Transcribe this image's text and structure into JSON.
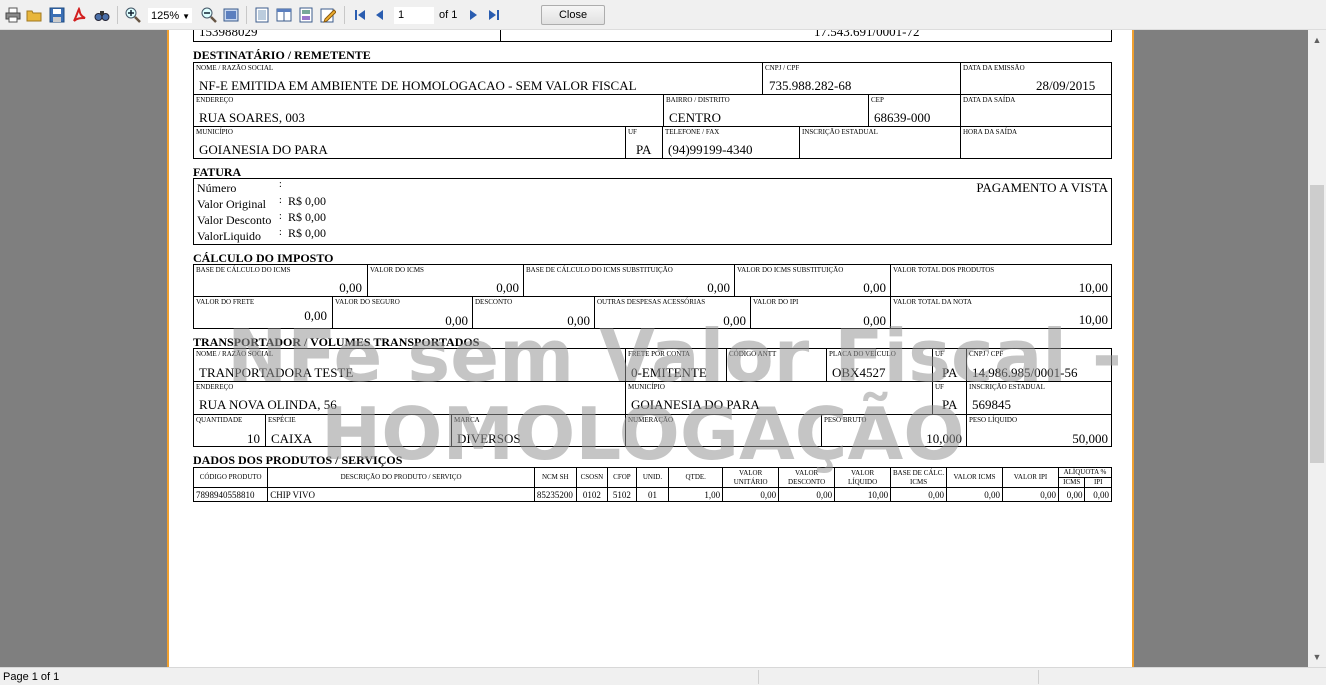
{
  "toolbar": {
    "zoom": "125%",
    "page_value": "1",
    "page_of": "of 1",
    "close_label": "Close",
    "icons": [
      "print-icon",
      "open-icon",
      "save-icon",
      "pdf-icon",
      "find-icon",
      "zoom-in-icon",
      "zoom-out-icon",
      "fit-page-icon",
      "single-page-icon",
      "two-page-icon",
      "thumbnails-icon",
      "edit-icon",
      "first-page-icon",
      "prev-page-icon",
      "next-page-icon",
      "last-page-icon"
    ]
  },
  "status": {
    "page_label": "Page 1 of 1"
  },
  "watermark": {
    "line1": "NFe sem Valor Fiscal -",
    "line2": "HOMOLOGAÇÃO"
  },
  "top_partial": {
    "left": "153988029",
    "right": "17.543.691/0001-72"
  },
  "dest": {
    "title": "DESTINATÁRIO / REMETENTE",
    "nome_label": "NOME / RAZÃO SOCIAL",
    "nome": "NF-E EMITIDA EM AMBIENTE DE HOMOLOGACAO - SEM VALOR FISCAL",
    "cnpj_label": "CNPJ / CPF",
    "cnpj": "735.988.282-68",
    "emissao_label": "DATA DA EMISSÃO",
    "emissao": "28/09/2015",
    "endereco_label": "ENDEREÇO",
    "endereco": "RUA SOARES, 003",
    "bairro_label": "BAIRRO / DISTRITO",
    "bairro": "CENTRO",
    "cep_label": "CEP",
    "cep": "68639-000",
    "saida_label": "DATA DA SAÍDA",
    "municipio_label": "MUNICÍPIO",
    "municipio": "GOIANESIA DO PARA",
    "uf_label": "UF",
    "uf": "PA",
    "fone_label": "TELEFONE / FAX",
    "fone": "(94)99199-4340",
    "ie_label": "INSCRIÇÃO ESTADUAL",
    "hora_label": "HORA DA SAÍDA"
  },
  "fatura": {
    "title": "FATURA",
    "numero_label": "Número",
    "original_label": "Valor Original",
    "desconto_label": "Valor Desconto",
    "liquido_label": "ValorLiquido",
    "colon": ":",
    "original": "R$ 0,00",
    "desconto": "R$ 0,00",
    "liquido": "R$ 0,00",
    "pagamento": "PAGAMENTO A VISTA"
  },
  "imposto": {
    "title": "CÁLCULO DO IMPOSTO",
    "r1": [
      {
        "label": "BASE DE CÁLCULO DO ICMS",
        "value": "0,00"
      },
      {
        "label": "VALOR DO ICMS",
        "value": "0,00"
      },
      {
        "label": "BASE DE CÁLCULO DO ICMS SUBSTITUIÇÃO",
        "value": "0,00"
      },
      {
        "label": "VALOR DO ICMS SUBSTITUIÇÃO",
        "value": "0,00"
      },
      {
        "label": "VALOR TOTAL DOS PRODUTOS",
        "value": "10,00"
      }
    ],
    "r2": [
      {
        "label": "VALOR DO FRETE",
        "value": "0,00"
      },
      {
        "label": "VALOR DO SEGURO",
        "value": "0,00"
      },
      {
        "label": "DESCONTO",
        "value": "0,00"
      },
      {
        "label": "OUTRAS DESPESAS ACESSÓRIAS",
        "value": "0,00"
      },
      {
        "label": "VALOR DO IPI",
        "value": "0,00"
      },
      {
        "label": "VALOR TOTAL DA NOTA",
        "value": "10,00"
      }
    ]
  },
  "transp": {
    "title": "TRANSPORTADOR / VOLUMES TRANSPORTADOS",
    "nome_label": "NOME / RAZÃO SOCIAL",
    "nome": "TRANPORTADORA TESTE",
    "frete_label": "FRETE POR CONTA",
    "frete": "0-EMITENTE",
    "antt_label": "CÓDIGO ANTT",
    "placa_label": "PLACA DO VEÍCULO",
    "placa": "OBX4527",
    "uf_label": "UF",
    "uf": "PA",
    "cnpj_label": "CNPJ / CPF",
    "cnpj": "14.986.985/0001-56",
    "endereco_label": "ENDEREÇO",
    "endereco": "RUA NOVA OLINDA, 56",
    "municipio_label": "MUNICÍPIO",
    "municipio": "GOIANESIA DO PARA",
    "uf2": "PA",
    "ie_label": "INSCRIÇÃO ESTADUAL",
    "ie": "569845",
    "qtd_label": "QUANTIDADE",
    "qtd": "10",
    "especie_label": "ESPÉCIE",
    "especie": "CAIXA",
    "marca_label": "MARCA",
    "marca": "DIVERSOS",
    "numeracao_label": "NUMERAÇÃO",
    "bruto_label": "PESO BRUTO",
    "bruto": "10,000",
    "liquido_label": "PESO LÍQUIDO",
    "liquido": "50,000"
  },
  "produtos": {
    "title": "DADOS DOS PRODUTOS / SERVIÇOS",
    "headers": [
      "CÓDIGO PRODUTO",
      "DESCRIÇÃO DO PRODUTO / SERVIÇO",
      "NCM SH",
      "CSOSN",
      "CFOP",
      "UNID.",
      "QTDE.",
      "VALOR UNITÁRIO",
      "VALOR DESCONTO",
      "VALOR LÍQUIDO",
      "BASE DE CÁLC. ICMS",
      "VALOR ICMS",
      "VALOR IPI",
      "ALÍQUOTA %",
      "ICMS",
      "IPI"
    ],
    "rows": [
      [
        "7898940558810",
        "CHIP VIVO",
        "85235200",
        "0102",
        "5102",
        "01",
        "1,00",
        "0,00",
        "0,00",
        "10,00",
        "0,00",
        "0,00",
        "0,00",
        "0,00",
        "0,00"
      ]
    ]
  }
}
